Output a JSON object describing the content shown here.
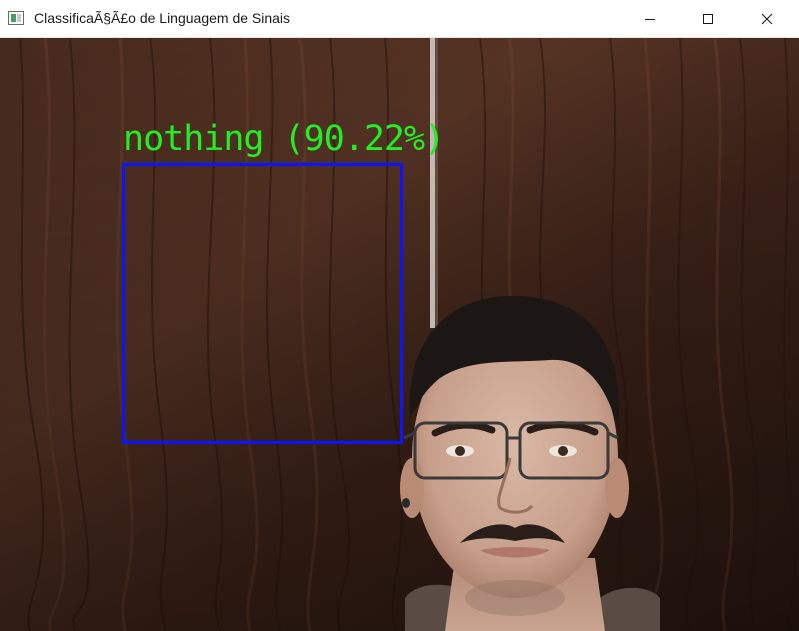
{
  "window": {
    "title": "ClassificaÃ§Ã£o de Linguagem de Sinais",
    "icons": {
      "app": "app-window-icon",
      "minimize": "minimize-icon",
      "maximize": "maximize-icon",
      "close": "close-icon"
    }
  },
  "overlay": {
    "prediction_text": "nothing (90.22%)",
    "prediction_color": "#22ee22",
    "roi_box_color": "#0a14ff"
  }
}
